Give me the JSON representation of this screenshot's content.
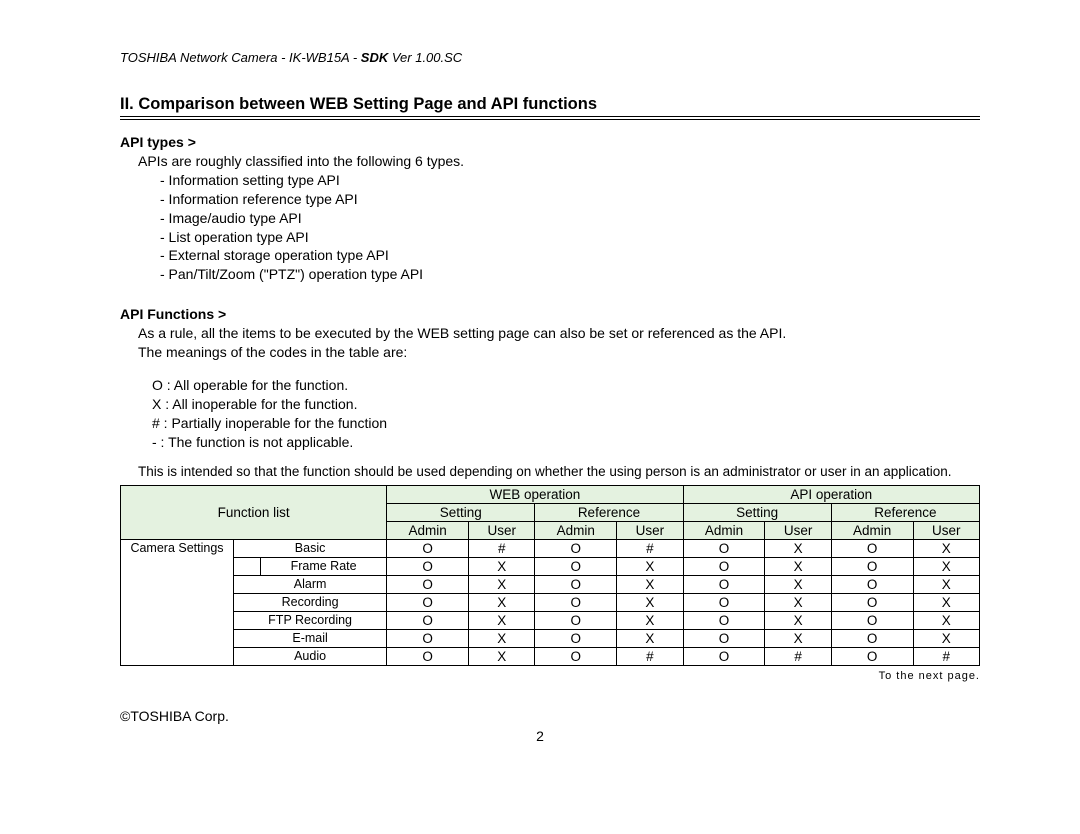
{
  "header": {
    "line1a": "TOSHIBA Network Camera - IK-WB15A - ",
    "line1b": "SDK ",
    "line1c": "Ver 1.00.SC"
  },
  "section_title": "II.   Comparison between WEB Setting Page and API functions",
  "api_types": {
    "heading": "API types >",
    "intro": "APIs are roughly classified into the following 6 types.",
    "items": [
      "- Information setting type API",
      "- Information reference type API",
      "- Image/audio type API",
      "- List operation type API",
      "- External storage operation type API",
      "- Pan/Tilt/Zoom (\"PTZ\") operation type API"
    ]
  },
  "api_functions": {
    "heading": "API Functions >",
    "intro": "As a rule, all the items to be executed by the WEB setting page can also be set or referenced as the API.",
    "codes_intro": "The meanings of the codes in the table are:",
    "codes": [
      "O : All operable for the function.",
      "X : All inoperable for the function.",
      "# : Partially inoperable for the function",
      "- : The function is not applicable."
    ],
    "note": "This is intended so that the function should be used depending on whether the using person is an administrator or user in an application."
  },
  "table": {
    "h_function_list": "Function list",
    "h_web": "WEB operation",
    "h_api": "API operation",
    "h_setting": "Setting",
    "h_reference": "Reference",
    "h_admin": "Admin",
    "h_user": "User",
    "group": "Camera Settings",
    "rows": [
      {
        "name": "Basic",
        "sub": false,
        "v": [
          "O",
          "#",
          "O",
          "#",
          "O",
          "X",
          "O",
          "X"
        ]
      },
      {
        "name": "Frame Rate",
        "sub": true,
        "v": [
          "O",
          "X",
          "O",
          "X",
          "O",
          "X",
          "O",
          "X"
        ]
      },
      {
        "name": "Alarm",
        "sub": false,
        "v": [
          "O",
          "X",
          "O",
          "X",
          "O",
          "X",
          "O",
          "X"
        ]
      },
      {
        "name": "Recording",
        "sub": false,
        "v": [
          "O",
          "X",
          "O",
          "X",
          "O",
          "X",
          "O",
          "X"
        ]
      },
      {
        "name": "FTP Recording",
        "sub": false,
        "v": [
          "O",
          "X",
          "O",
          "X",
          "O",
          "X",
          "O",
          "X"
        ]
      },
      {
        "name": "E-mail",
        "sub": false,
        "v": [
          "O",
          "X",
          "O",
          "X",
          "O",
          "X",
          "O",
          "X"
        ]
      },
      {
        "name": "Audio",
        "sub": false,
        "v": [
          "O",
          "X",
          "O",
          "#",
          "O",
          "#",
          "O",
          "#"
        ]
      }
    ]
  },
  "next_page": "To the next page.",
  "footer": "©TOSHIBA Corp.",
  "page_num": "2"
}
